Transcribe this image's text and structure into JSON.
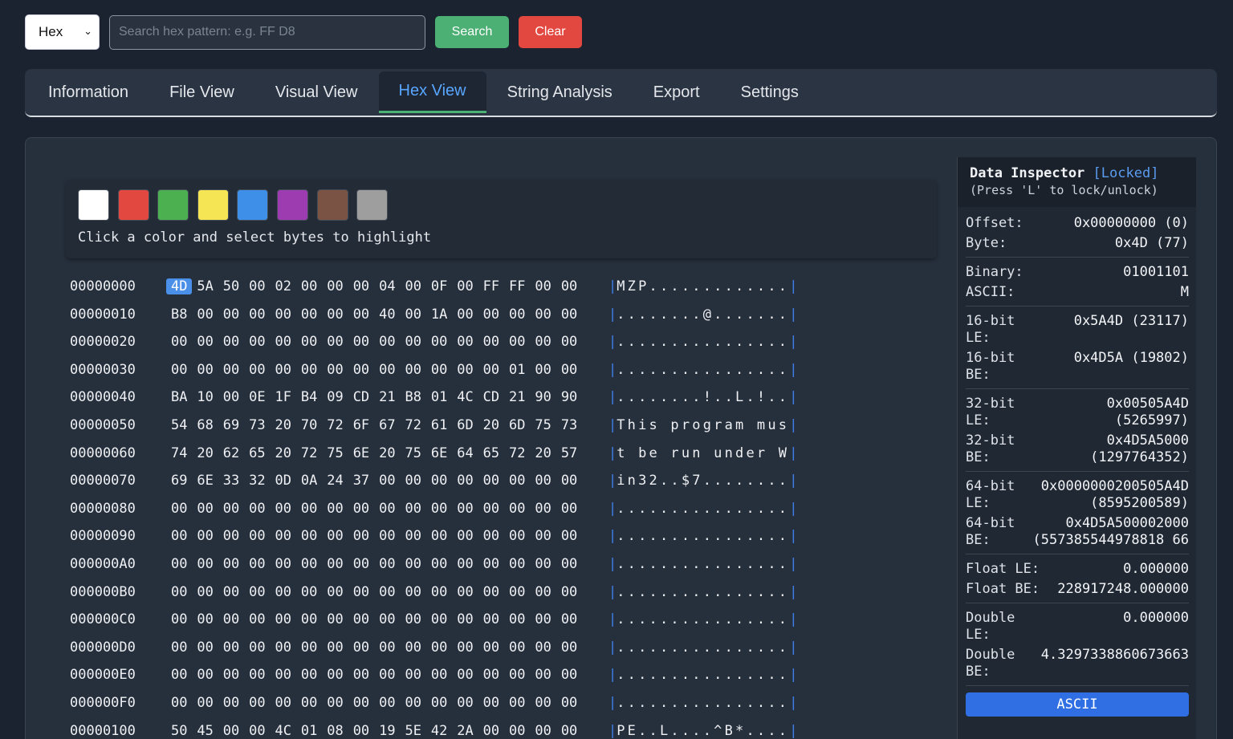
{
  "toolbar": {
    "mode_value": "Hex",
    "search_placeholder": "Search hex pattern: e.g. FF D8",
    "search_label": "Search",
    "clear_label": "Clear"
  },
  "tabs": [
    {
      "label": "Information"
    },
    {
      "label": "File View"
    },
    {
      "label": "Visual View"
    },
    {
      "label": "Hex View",
      "active": true
    },
    {
      "label": "String Analysis"
    },
    {
      "label": "Export"
    },
    {
      "label": "Settings"
    }
  ],
  "highlight": {
    "colors": [
      "#ffffff",
      "#e2483f",
      "#4caf50",
      "#f5e453",
      "#3d8fe8",
      "#9c3cb0",
      "#7a5344",
      "#9e9e9e"
    ],
    "hint": "Click a color and select bytes to highlight"
  },
  "hex": {
    "selected_offset": "00000000",
    "selected_index": 0,
    "rows": [
      {
        "offset": "00000000",
        "bytes": [
          "4D",
          "5A",
          "50",
          "00",
          "02",
          "00",
          "00",
          "00",
          "04",
          "00",
          "0F",
          "00",
          "FF",
          "FF",
          "00",
          "00"
        ],
        "ascii": "MZP............."
      },
      {
        "offset": "00000010",
        "bytes": [
          "B8",
          "00",
          "00",
          "00",
          "00",
          "00",
          "00",
          "00",
          "40",
          "00",
          "1A",
          "00",
          "00",
          "00",
          "00",
          "00"
        ],
        "ascii": "........@......."
      },
      {
        "offset": "00000020",
        "bytes": [
          "00",
          "00",
          "00",
          "00",
          "00",
          "00",
          "00",
          "00",
          "00",
          "00",
          "00",
          "00",
          "00",
          "00",
          "00",
          "00"
        ],
        "ascii": "................"
      },
      {
        "offset": "00000030",
        "bytes": [
          "00",
          "00",
          "00",
          "00",
          "00",
          "00",
          "00",
          "00",
          "00",
          "00",
          "00",
          "00",
          "00",
          "01",
          "00",
          "00"
        ],
        "ascii": "................"
      },
      {
        "offset": "00000040",
        "bytes": [
          "BA",
          "10",
          "00",
          "0E",
          "1F",
          "B4",
          "09",
          "CD",
          "21",
          "B8",
          "01",
          "4C",
          "CD",
          "21",
          "90",
          "90"
        ],
        "ascii": "........!..L.!.."
      },
      {
        "offset": "00000050",
        "bytes": [
          "54",
          "68",
          "69",
          "73",
          "20",
          "70",
          "72",
          "6F",
          "67",
          "72",
          "61",
          "6D",
          "20",
          "6D",
          "75",
          "73"
        ],
        "ascii": "This program mus"
      },
      {
        "offset": "00000060",
        "bytes": [
          "74",
          "20",
          "62",
          "65",
          "20",
          "72",
          "75",
          "6E",
          "20",
          "75",
          "6E",
          "64",
          "65",
          "72",
          "20",
          "57"
        ],
        "ascii": "t be run under W"
      },
      {
        "offset": "00000070",
        "bytes": [
          "69",
          "6E",
          "33",
          "32",
          "0D",
          "0A",
          "24",
          "37",
          "00",
          "00",
          "00",
          "00",
          "00",
          "00",
          "00",
          "00"
        ],
        "ascii": "in32..$7........"
      },
      {
        "offset": "00000080",
        "bytes": [
          "00",
          "00",
          "00",
          "00",
          "00",
          "00",
          "00",
          "00",
          "00",
          "00",
          "00",
          "00",
          "00",
          "00",
          "00",
          "00"
        ],
        "ascii": "................"
      },
      {
        "offset": "00000090",
        "bytes": [
          "00",
          "00",
          "00",
          "00",
          "00",
          "00",
          "00",
          "00",
          "00",
          "00",
          "00",
          "00",
          "00",
          "00",
          "00",
          "00"
        ],
        "ascii": "................"
      },
      {
        "offset": "000000A0",
        "bytes": [
          "00",
          "00",
          "00",
          "00",
          "00",
          "00",
          "00",
          "00",
          "00",
          "00",
          "00",
          "00",
          "00",
          "00",
          "00",
          "00"
        ],
        "ascii": "................"
      },
      {
        "offset": "000000B0",
        "bytes": [
          "00",
          "00",
          "00",
          "00",
          "00",
          "00",
          "00",
          "00",
          "00",
          "00",
          "00",
          "00",
          "00",
          "00",
          "00",
          "00"
        ],
        "ascii": "................"
      },
      {
        "offset": "000000C0",
        "bytes": [
          "00",
          "00",
          "00",
          "00",
          "00",
          "00",
          "00",
          "00",
          "00",
          "00",
          "00",
          "00",
          "00",
          "00",
          "00",
          "00"
        ],
        "ascii": "................"
      },
      {
        "offset": "000000D0",
        "bytes": [
          "00",
          "00",
          "00",
          "00",
          "00",
          "00",
          "00",
          "00",
          "00",
          "00",
          "00",
          "00",
          "00",
          "00",
          "00",
          "00"
        ],
        "ascii": "................"
      },
      {
        "offset": "000000E0",
        "bytes": [
          "00",
          "00",
          "00",
          "00",
          "00",
          "00",
          "00",
          "00",
          "00",
          "00",
          "00",
          "00",
          "00",
          "00",
          "00",
          "00"
        ],
        "ascii": "................"
      },
      {
        "offset": "000000F0",
        "bytes": [
          "00",
          "00",
          "00",
          "00",
          "00",
          "00",
          "00",
          "00",
          "00",
          "00",
          "00",
          "00",
          "00",
          "00",
          "00",
          "00"
        ],
        "ascii": "................"
      },
      {
        "offset": "00000100",
        "bytes": [
          "50",
          "45",
          "00",
          "00",
          "4C",
          "01",
          "08",
          "00",
          "19",
          "5E",
          "42",
          "2A",
          "00",
          "00",
          "00",
          "00"
        ],
        "ascii": "PE..L....^B*...."
      }
    ]
  },
  "inspector": {
    "title": "Data Inspector",
    "locked": "[Locked]",
    "note": "(Press 'L' to lock/unlock)",
    "groups": [
      [
        {
          "k": "Offset:",
          "v": "0x00000000 (0)"
        },
        {
          "k": "Byte:",
          "v": "0x4D (77)"
        }
      ],
      [
        {
          "k": "Binary:",
          "v": "01001101"
        },
        {
          "k": "ASCII:",
          "v": "M"
        }
      ],
      [
        {
          "k": "16-bit LE:",
          "v": "0x5A4D (23117)"
        },
        {
          "k": "16-bit BE:",
          "v": "0x4D5A (19802)"
        }
      ],
      [
        {
          "k": "32-bit LE:",
          "v": "0x00505A4D (5265997)"
        },
        {
          "k": "32-bit BE:",
          "v": "0x4D5A5000 (1297764352)"
        }
      ],
      [
        {
          "k": "64-bit LE:",
          "v": "0x0000000200505A4D (8595200589)"
        },
        {
          "k": "64-bit BE:",
          "v": "0x4D5A500002000 (557385544978818 66"
        }
      ],
      [
        {
          "k": "Float LE:",
          "v": "0.000000"
        },
        {
          "k": "Float BE:",
          "v": "228917248.000000"
        }
      ],
      [
        {
          "k": "Double LE:",
          "v": "0.000000"
        },
        {
          "k": "Double BE:",
          "v": "4.3297338860673663"
        }
      ]
    ],
    "ascii_button": "ASCII"
  }
}
